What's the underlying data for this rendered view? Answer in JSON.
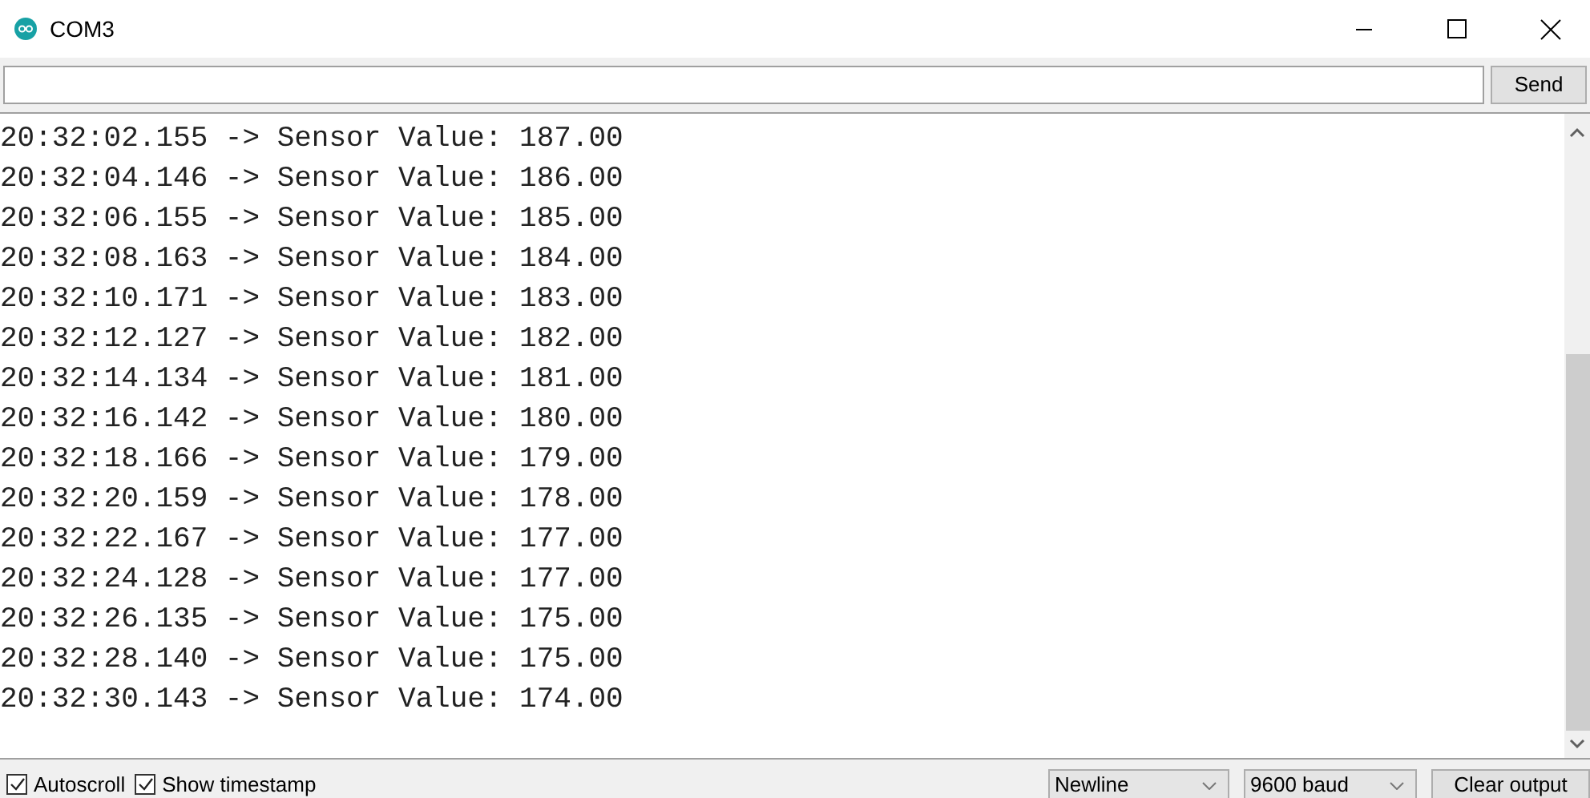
{
  "window": {
    "title": "COM3"
  },
  "send_button": "Send",
  "output_lines": [
    "20:32:02.155 -> Sensor Value: 187.00",
    "20:32:04.146 -> Sensor Value: 186.00",
    "20:32:06.155 -> Sensor Value: 185.00",
    "20:32:08.163 -> Sensor Value: 184.00",
    "20:32:10.171 -> Sensor Value: 183.00",
    "20:32:12.127 -> Sensor Value: 182.00",
    "20:32:14.134 -> Sensor Value: 181.00",
    "20:32:16.142 -> Sensor Value: 180.00",
    "20:32:18.166 -> Sensor Value: 179.00",
    "20:32:20.159 -> Sensor Value: 178.00",
    "20:32:22.167 -> Sensor Value: 177.00",
    "20:32:24.128 -> Sensor Value: 177.00",
    "20:32:26.135 -> Sensor Value: 175.00",
    "20:32:28.140 -> Sensor Value: 175.00",
    "20:32:30.143 -> Sensor Value: 174.00"
  ],
  "options": [
    {
      "label": "Autoscroll",
      "checked": true
    },
    {
      "label": "Show timestamp",
      "checked": true
    }
  ],
  "line_ending": "Newline",
  "baud_rate": "9600 baud",
  "clear_button": "Clear output"
}
